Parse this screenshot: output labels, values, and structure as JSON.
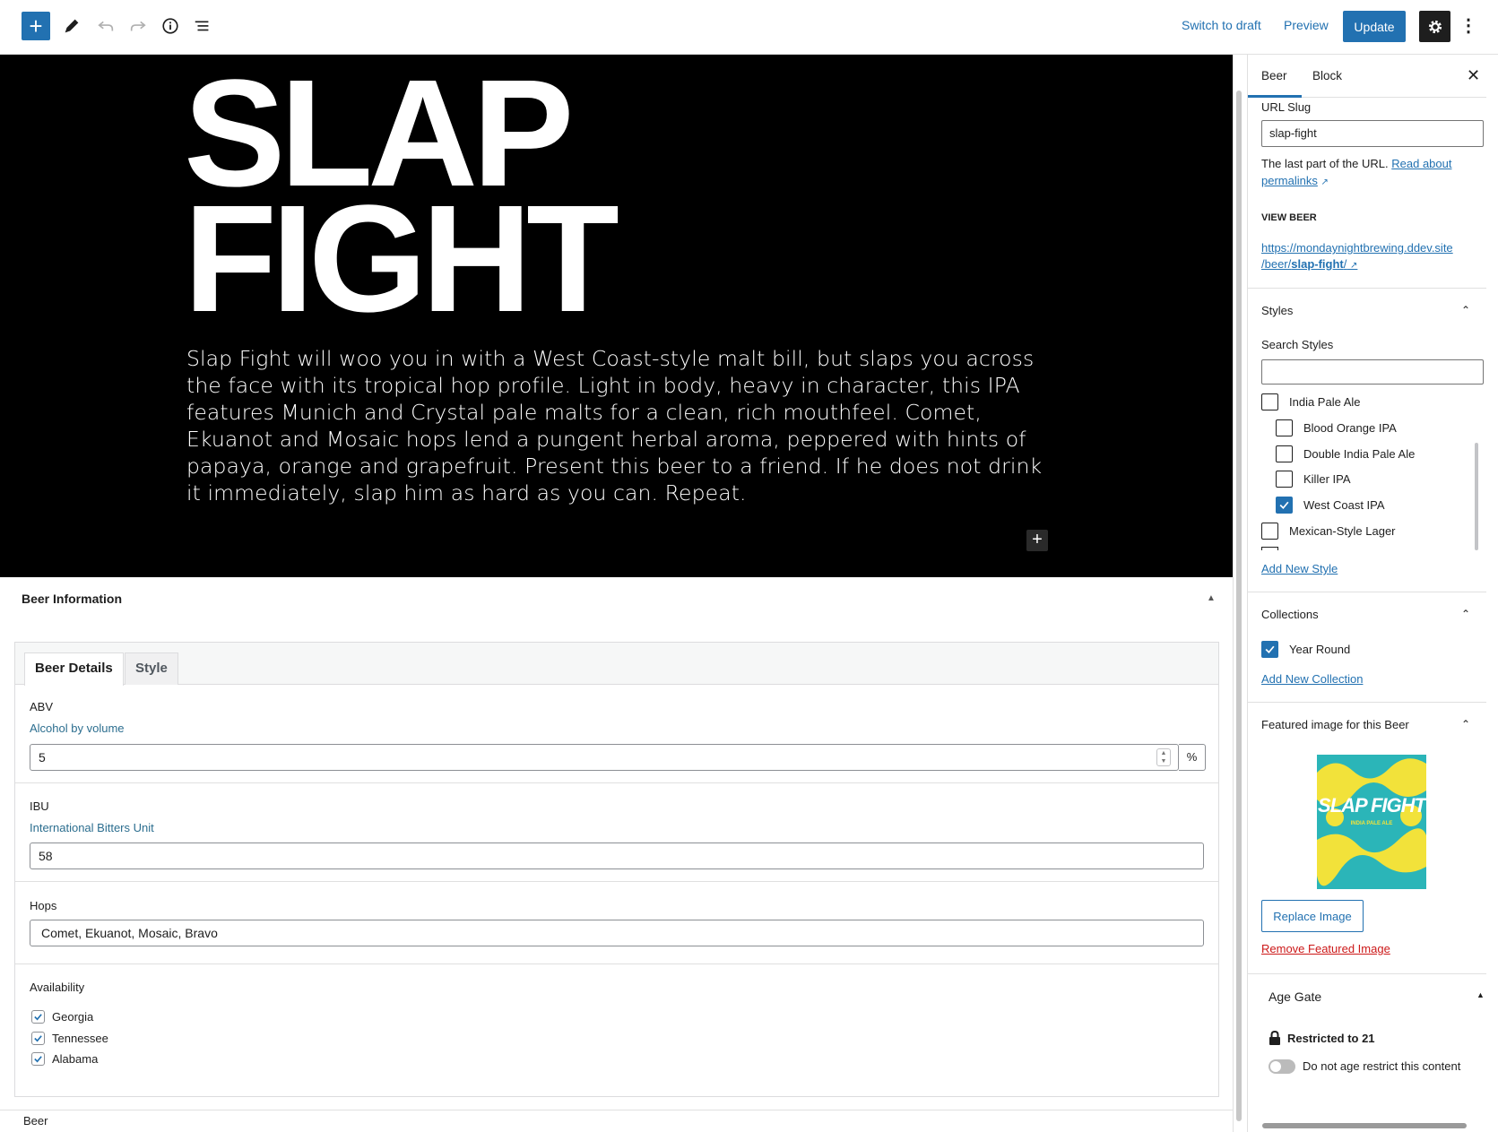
{
  "toolbar": {
    "add_label": "+",
    "switch_to_draft": "Switch to draft",
    "preview": "Preview",
    "update": "Update",
    "more": "⋮"
  },
  "hero": {
    "title_line1": "SLAP",
    "title_line2": "FIGHT",
    "description": "Slap Fight will woo you in with a West Coast-style malt bill, but slaps you across the face with its tropical hop profile. Light in body, heavy in character, this IPA features Munich and Crystal pale malts for a clean, rich mouthfeel. Comet, Ekuanot and Mosaic hops lend a pungent herbal aroma, peppered with hints of papaya, orange and grapefruit. Present this beer to a friend. If he does not drink it immediately, slap him as hard as you can. Repeat.",
    "add_block": "+"
  },
  "beer_info": {
    "title": "Beer Information",
    "tabs": [
      "Beer Details",
      "Style"
    ],
    "abv": {
      "label": "ABV",
      "desc": "Alcohol by volume",
      "value": "5",
      "unit": "%"
    },
    "ibu": {
      "label": "IBU",
      "desc": "International Bitters Unit",
      "value": "58"
    },
    "hops": {
      "label": "Hops",
      "value": "Comet, Ekuanot, Mosaic, Bravo"
    },
    "availability": {
      "label": "Availability",
      "items": [
        "Georgia",
        "Tennessee",
        "Alabama"
      ]
    }
  },
  "footer": {
    "breadcrumb": "Beer"
  },
  "sidebar": {
    "tabs": [
      "Beer",
      "Block"
    ],
    "close": "✕",
    "url_slug": {
      "label": "URL Slug",
      "value": "slap-fight",
      "help": "The last part of the URL.",
      "help_link_1": "Read about",
      "help_link_2": "permalinks",
      "view_label": "VIEW BEER",
      "view_url_1": "https://mondaynightbrewing.ddev.site",
      "view_url_2a": "/beer/",
      "view_url_2b": "slap-fight",
      "view_url_2c": "/"
    },
    "styles": {
      "title": "Styles",
      "search_label": "Search Styles",
      "items": [
        {
          "label": "India Pale Ale",
          "checked": false,
          "child": false
        },
        {
          "label": "Blood Orange IPA",
          "checked": false,
          "child": true
        },
        {
          "label": "Double India Pale Ale",
          "checked": false,
          "child": true
        },
        {
          "label": "Killer IPA",
          "checked": false,
          "child": true
        },
        {
          "label": "West Coast IPA",
          "checked": true,
          "child": true
        },
        {
          "label": "Mexican-Style Lager",
          "checked": false,
          "child": false
        }
      ],
      "add_new": "Add New Style"
    },
    "collections": {
      "title": "Collections",
      "item": "Year Round",
      "add_new": "Add New Collection"
    },
    "featured": {
      "title": "Featured image for this Beer",
      "image_text_1": "SLAP FIGHT",
      "image_text_2": "INDIA PALE ALE",
      "replace": "Replace Image",
      "remove": "Remove Featured Image"
    },
    "age_gate": {
      "title": "Age Gate",
      "restricted": "Restricted to 21",
      "toggle_label": "Do not age restrict this content"
    }
  },
  "colors": {
    "accent": "#2271b1",
    "danger": "#cc1818",
    "hero_bg": "#000000"
  }
}
